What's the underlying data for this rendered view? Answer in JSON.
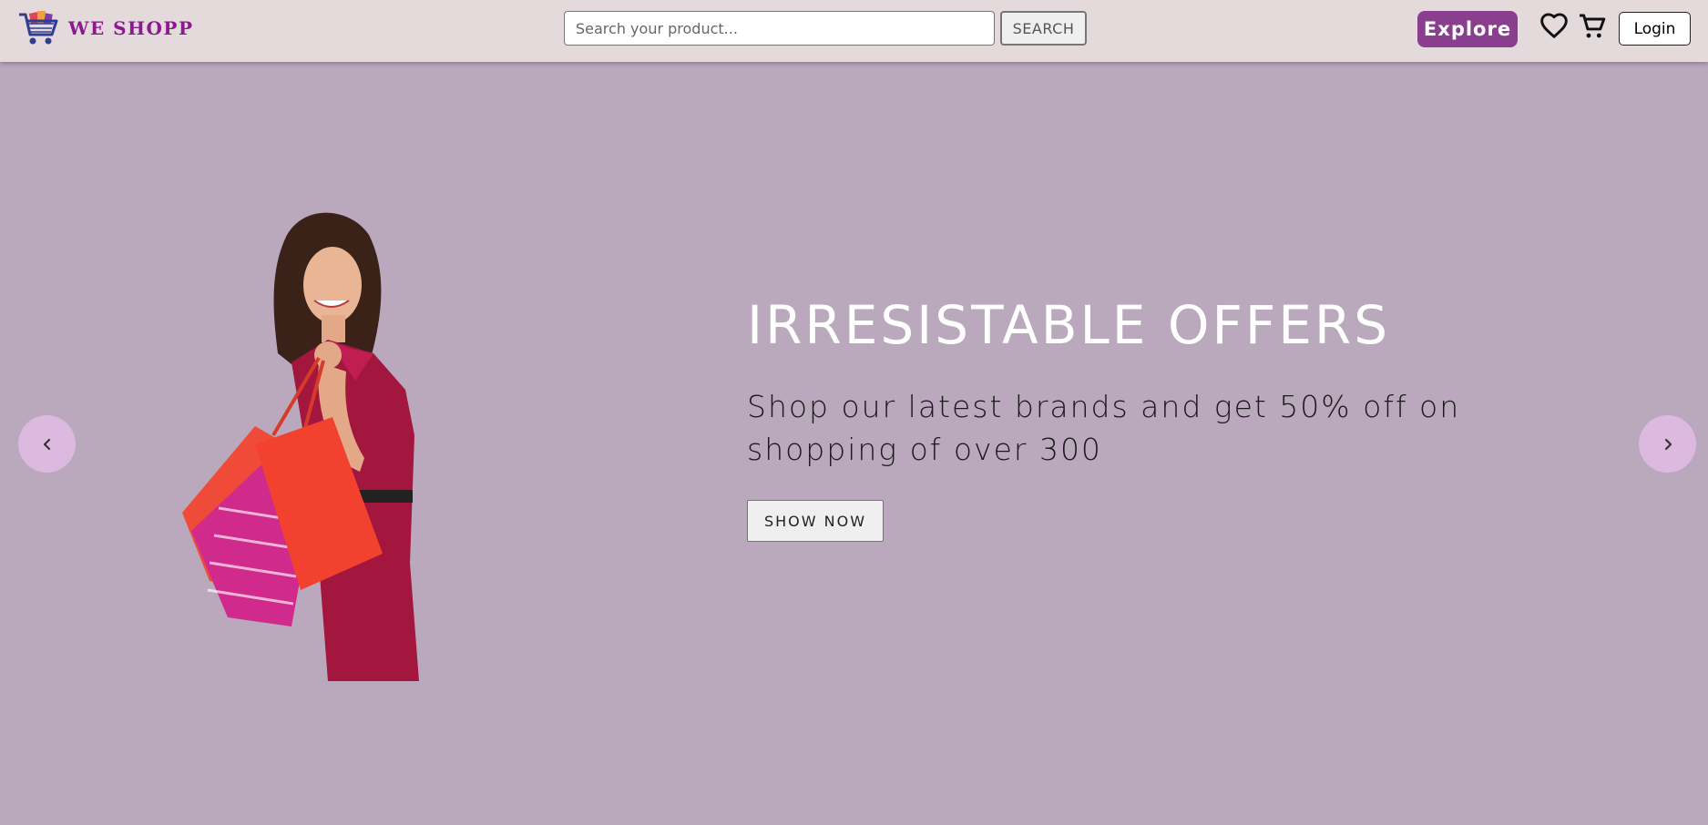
{
  "header": {
    "brand": "WE SHOPP",
    "search": {
      "placeholder": "Search your product...",
      "value": "",
      "button_label": "SEARCH"
    },
    "explore_label": "Explore",
    "login_label": "Login",
    "icons": [
      "shopping-cart-logo-icon",
      "heart-icon",
      "cart-icon"
    ]
  },
  "hero": {
    "title": "IRRESISTABLE OFFERS",
    "subtitle": "Shop our latest brands and get 50% off on shopping of over 300",
    "cta_label": "SHOW NOW",
    "prev_icon": "chevron-left-icon",
    "next_icon": "chevron-right-icon"
  },
  "colors": {
    "nav_background": "#e4d9db",
    "hero_background": "#baa9bc",
    "brand": "#8b1a8f",
    "explore_button": "#8a3e8e",
    "arrow_button": "#dcb9de"
  }
}
